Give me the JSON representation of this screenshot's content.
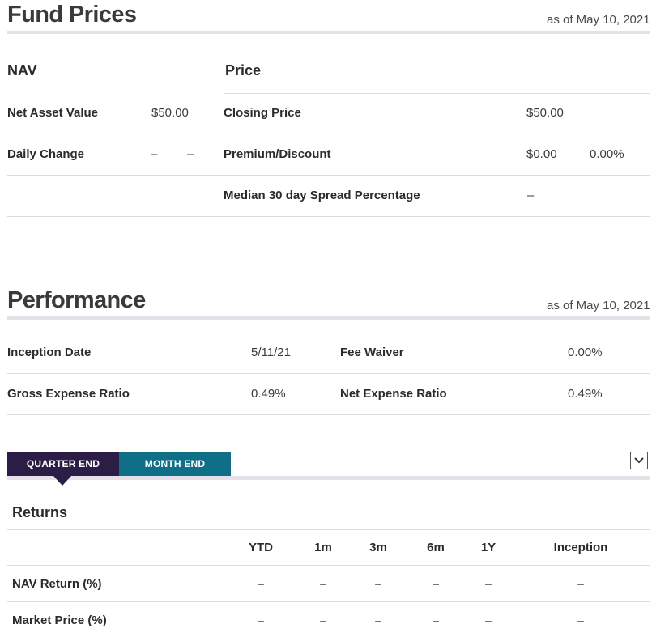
{
  "fund_prices": {
    "title": "Fund Prices",
    "as_of": "as of May 10, 2021",
    "nav": {
      "heading": "NAV",
      "net_asset_value_label": "Net Asset Value",
      "net_asset_value": "$50.00",
      "daily_change_label": "Daily Change",
      "daily_change_1": "–",
      "daily_change_2": "–"
    },
    "price": {
      "heading": "Price",
      "closing_price_label": "Closing Price",
      "closing_price": "$50.00",
      "premium_discount_label": "Premium/Discount",
      "premium_discount_value": "$0.00",
      "premium_discount_pct": "0.00%",
      "median_spread_label": "Median 30 day Spread Percentage",
      "median_spread_value": "–"
    }
  },
  "performance": {
    "title": "Performance",
    "as_of": "as of May 10, 2021",
    "inception_date_label": "Inception Date",
    "inception_date": "5/11/21",
    "fee_waiver_label": "Fee Waiver",
    "fee_waiver": "0.00%",
    "gross_expense_ratio_label": "Gross Expense Ratio",
    "gross_expense_ratio": "0.49%",
    "net_expense_ratio_label": "Net Expense Ratio",
    "net_expense_ratio": "0.49%"
  },
  "tabs": {
    "quarter_end": "QUARTER END",
    "month_end": "MONTH END",
    "dropdown_icon": "chevron-down-icon"
  },
  "returns": {
    "title": "Returns",
    "columns": [
      "YTD",
      "1m",
      "3m",
      "6m",
      "1Y",
      "Inception"
    ],
    "rows": [
      {
        "label": "NAV Return (%)",
        "values": [
          "–",
          "–",
          "–",
          "–",
          "–",
          "–"
        ]
      },
      {
        "label": "Market Price (%)",
        "values": [
          "–",
          "–",
          "–",
          "–",
          "–",
          "–"
        ]
      }
    ]
  },
  "colors": {
    "tab_active": "#2b1d45",
    "tab_inactive": "#0f6f86",
    "title_rule": "#e6e0ea"
  }
}
